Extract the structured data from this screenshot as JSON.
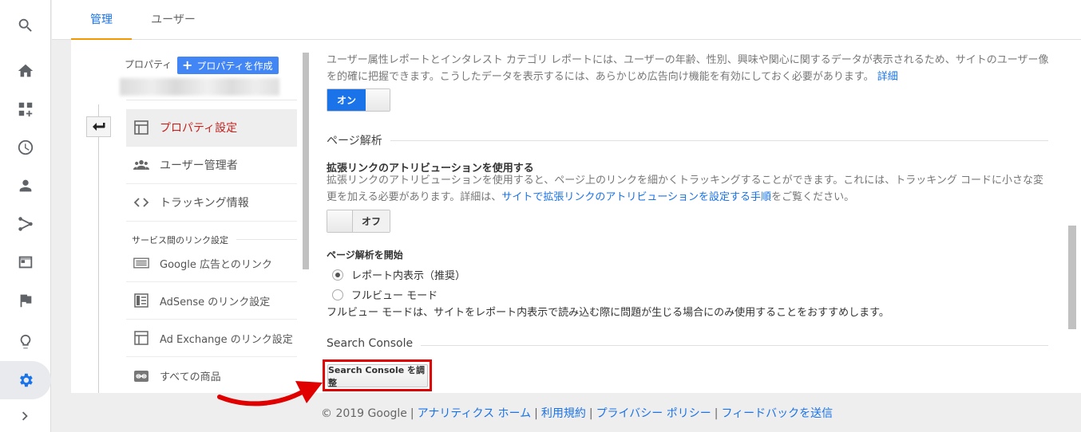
{
  "tabs": [
    "管理",
    "ユーザー"
  ],
  "property": {
    "label": "プロパティ",
    "create_button": "プロパティを作成"
  },
  "nav": {
    "items": [
      {
        "label": "プロパティ設定",
        "icon": "property-settings-icon"
      },
      {
        "label": "ユーザー管理者",
        "icon": "users-icon"
      },
      {
        "label": "トラッキング情報",
        "icon": "code-icon"
      }
    ],
    "section_title": "サービス間のリンク設定",
    "link_items": [
      {
        "label": "Google 広告とのリンク",
        "icon": "google-ads-icon"
      },
      {
        "label": "AdSense のリンク設定",
        "icon": "adsense-icon"
      },
      {
        "label": "Ad Exchange のリンク設定",
        "icon": "ad-exchange-icon"
      },
      {
        "label": "すべての商品",
        "icon": "link-icon"
      }
    ]
  },
  "content": {
    "demographics_text_1": "ユーザー属性レポートとインタレスト カテゴリ レポートには、ユーザーの年齢、性別、興味や関心に関するデータが表示されるため、サイトのユーザー像",
    "demographics_text_2": "を的確に把握できます。こうしたデータを表示するには、あらかじめ広告向け機能を有効にしておく必要があります。",
    "demographics_link": "詳細",
    "toggle_on_label": "オン",
    "page_analytics_title": "ページ解析",
    "enhanced_link_heading": "拡張リンクのアトリビューションを使用する",
    "enhanced_link_text_1": "拡張リンクのアトリビューションを使用すると、ページ上のリンクを細かくトラッキングすることができます。これには、トラッキング コードに小さな変",
    "enhanced_link_text_2": "更を加える必要があります。詳細は、",
    "enhanced_link_link": "サイトで拡張リンクのアトリビューションを設定する手順",
    "enhanced_link_text_3": "をご覧ください。",
    "toggle_off_label": "オフ",
    "page_analytics_start_heading": "ページ解析を開始",
    "radio_in_report": "レポート内表示（推奨）",
    "radio_full_view": "フルビュー モード",
    "full_view_note": "フルビュー モードは、サイトをレポート内表示で読み込む際に問題が生じる場合にのみ使用することをおすすめします。",
    "search_console_title": "Search Console",
    "search_console_button": "Search Console を調整"
  },
  "footer": {
    "copyright": "© 2019 Google",
    "links": [
      "アナリティクス ホーム",
      "利用規約",
      "プライバシー ポリシー",
      "フィードバックを送信"
    ]
  },
  "colors": {
    "accent": "#1a73e8",
    "active_nav": "#c5221f",
    "highlight_box": "#e00000",
    "tab_underline": "#f29900"
  }
}
